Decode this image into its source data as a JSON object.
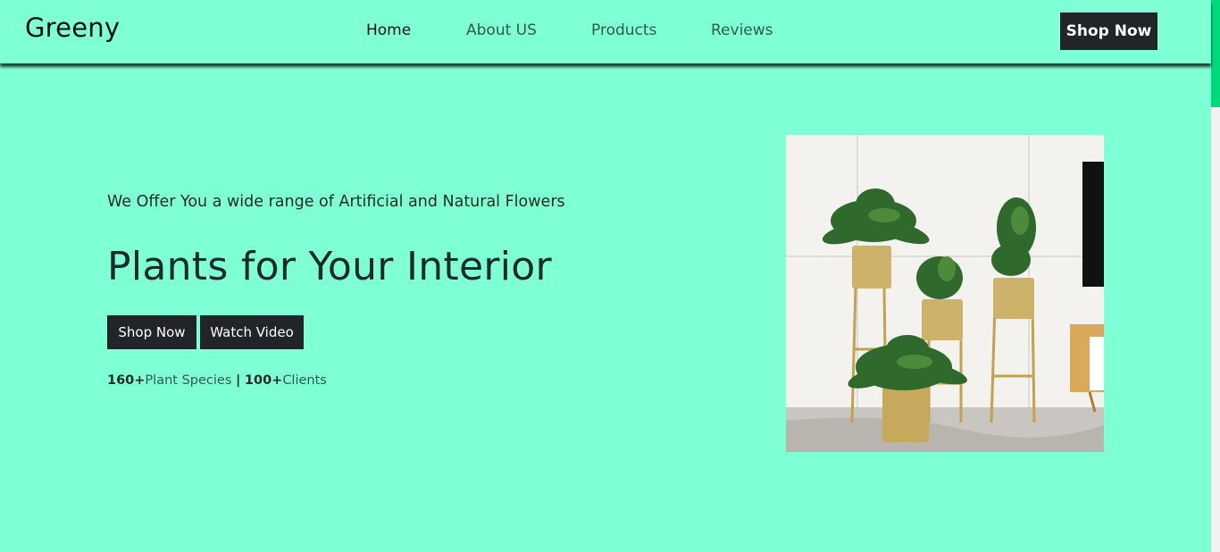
{
  "header": {
    "brand": "Greeny",
    "nav": [
      {
        "label": "Home",
        "active": true
      },
      {
        "label": "About US",
        "active": false
      },
      {
        "label": "Products",
        "active": false
      },
      {
        "label": "Reviews",
        "active": false
      }
    ],
    "cta_label": "Shop Now"
  },
  "hero": {
    "tagline": "We Offer You a wide range of Artificial and Natural Flowers",
    "title": "Plants for Your Interior",
    "primary_button": "Shop Now",
    "secondary_button": "Watch Video",
    "stats": {
      "species_count": "160+",
      "species_label": "Plant Species",
      "separator": "|",
      "clients_count": "100+",
      "clients_label": "Clients"
    },
    "image_icon": "potted-plants-image"
  },
  "colors": {
    "background": "#7fffd4",
    "button": "#212529",
    "button_text": "#ffffff",
    "scroll_thumb": "#00d97a"
  }
}
